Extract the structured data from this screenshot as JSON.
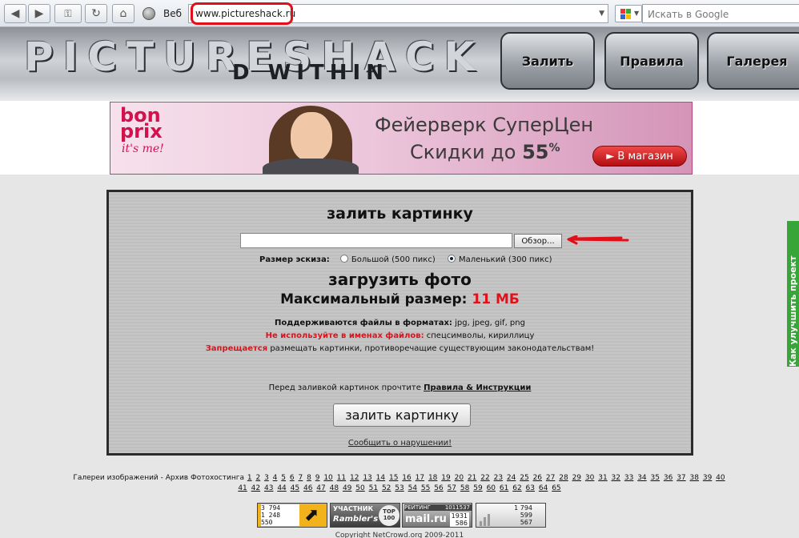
{
  "browser": {
    "web_label": "Веб",
    "url": "www.pictureshack.ru",
    "search_placeholder": "Искать в Google"
  },
  "header": {
    "logo_top": "PICTURESHACK",
    "logo_bottom": "D WITHIN",
    "nav": [
      "Залить",
      "Правила",
      "Галерея"
    ]
  },
  "banner": {
    "brand_top": "bon prix",
    "brand_tag": "it's me!",
    "line1": "Фейерверк СуперЦен",
    "line2_prefix": "Скидки до ",
    "line2_value": "55",
    "line2_suffix": "%",
    "button": "► В магазин"
  },
  "feedback_tab": "Как улучшить проект",
  "upload": {
    "title": "залить картинку",
    "browse": "Обзор...",
    "size_label": "Размер эскиза:",
    "size_large": "Большой (500 пикс)",
    "size_small": "Маленький (300 пикс)",
    "heading": "загрузить фото",
    "max_label": "Максимальный размер: ",
    "max_value": "11 МБ",
    "formats_label": "Поддерживаются файлы в форматах:",
    "formats_value": " jpg, jpeg, gif, png",
    "names_label": "Не используйте в именах файлов:",
    "names_value": " спецсимволы, кириллицу",
    "forbid_label": "Запрещается",
    "forbid_value": " размещать картинки, противоречащие существующим законодательствам!",
    "rules_prefix": "Перед заливкой картинок прочтите ",
    "rules_link": "Правила & Инструкции",
    "submit": "залить картинку",
    "report": "Сообщить о нарушении!"
  },
  "footer": {
    "gallery_prefix": "Галереи изображений - Архив Фотохостинга",
    "pages_row1": [
      "1",
      "2",
      "3",
      "4",
      "5",
      "6",
      "7",
      "8",
      "9",
      "10",
      "11",
      "12",
      "13",
      "14",
      "15",
      "16",
      "17",
      "18",
      "19",
      "20",
      "21",
      "22",
      "23",
      "24",
      "25",
      "26",
      "27",
      "28",
      "29",
      "30",
      "31",
      "32",
      "33",
      "34",
      "35",
      "36",
      "37",
      "38",
      "39",
      "40"
    ],
    "pages_row2": [
      "41",
      "42",
      "43",
      "44",
      "45",
      "46",
      "47",
      "48",
      "49",
      "50",
      "51",
      "52",
      "53",
      "54",
      "55",
      "56",
      "57",
      "58",
      "59",
      "60",
      "61",
      "62",
      "63",
      "64",
      "65"
    ],
    "counter1": [
      "3 794",
      "1 248",
      "550"
    ],
    "counter2_top": "УЧАСТНИК",
    "counter2_brand": "Rambler's",
    "counter2_badge": "TOP 100",
    "counter3_top": "РЕЙТИНГ",
    "counter3_num": "1011537",
    "counter3_brand": "mail.ru",
    "counter3_a": "1931",
    "counter3_b": "586",
    "counter4": [
      "1 794",
      "599",
      "567"
    ],
    "copyright": "Copyright NetCrowd.org 2009-2011"
  }
}
